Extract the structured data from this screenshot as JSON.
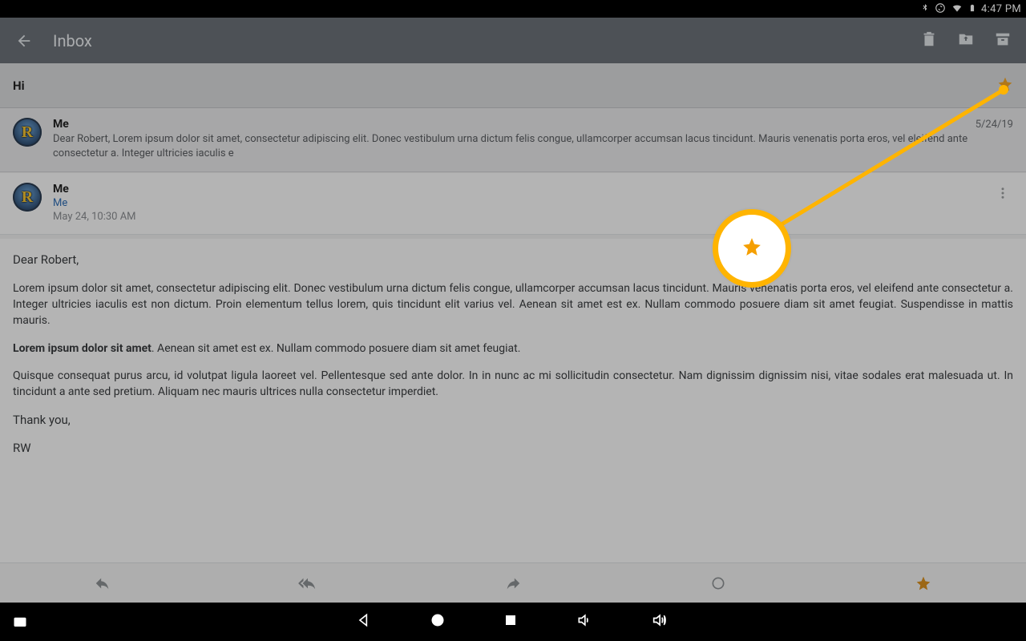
{
  "status": {
    "time": "4:47 PM"
  },
  "appbar": {
    "title": "Inbox"
  },
  "subject": "Hi",
  "preview": {
    "sender": "Me",
    "date": "5/24/19",
    "body": "Dear Robert, Lorem ipsum dolor sit amet, consectetur adipiscing elit. Donec vestibulum urna dictum felis congue, ullamcorper accumsan lacus tincidunt. Mauris venenatis porta eros, vel eleifend ante consectetur a. Integer ultricies iaculis e"
  },
  "expanded": {
    "sender": "Me",
    "to": "Me",
    "timestamp": "May 24, 10:30 AM"
  },
  "body": {
    "greeting": "Dear Robert,",
    "p1": "Lorem ipsum dolor sit amet, consectetur adipiscing elit. Donec vestibulum urna dictum felis congue, ullamcorper accumsan lacus tincidunt. Mauris venenatis porta eros, vel eleifend ante consectetur a. Integer ultricies iaculis est non dictum. Proin elementum tellus lorem, quis tincidunt elit varius vel. Aenean sit amet est ex. Nullam commodo posuere diam sit amet feugiat. Suspendisse in mattis mauris.",
    "p2_bold": "Lorem ipsum dolor sit amet",
    "p2_rest": ". Aenean sit amet est ex. Nullam commodo posuere diam sit amet feugiat.",
    "p3": "Quisque consequat purus arcu, id volutpat ligula laoreet vel. Pellentesque sed ante dolor. In in nunc ac mi sollicitudin consectetur. Nam dignissim dignissim nisi, vitae sodales erat malesuada ut. In tincidunt a ante sed pretium. Aliquam nec mauris ultrices nulla consectetur imperdiet.",
    "thanks": "Thank you,",
    "signature": "RW"
  }
}
